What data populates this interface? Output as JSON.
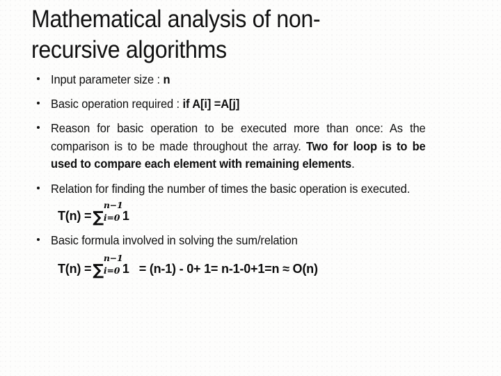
{
  "slide": {
    "title_line1": "Mathematical analysis of non-",
    "title_line2": "recursive algorithms",
    "bullets": [
      {
        "name": "input-parameter-size",
        "plain": "Input parameter size : ",
        "bold": "n",
        "trail": ""
      },
      {
        "name": "basic-operation-required",
        "plain": "Basic operation required : ",
        "bold": "if A[i] =A[j]",
        "trail": ""
      },
      {
        "name": "reason-for-basic-operation",
        "plain": "Reason for basic operation to be executed more than once: As the comparison is to be made throughout the array. ",
        "bold": "Two for loop is to be used to compare each element with remaining elements",
        "trail": "."
      },
      {
        "name": "relation-for-finding-number-of-times",
        "plain": "Relation for finding the number of times the basic operation is executed.",
        "bold": "",
        "trail": ""
      },
      {
        "name": "basic-formula-involved",
        "plain": "Basic formula involved in solving the sum/relation",
        "bold": "",
        "trail": ""
      }
    ],
    "formula_1": {
      "lhs": "T(n) =",
      "sigma": "∑",
      "upper": "n−1",
      "lower": "i=0",
      "summand": "1",
      "tail": ""
    },
    "formula_2": {
      "lhs": "T(n) =",
      "sigma": "∑",
      "upper": "n−1",
      "lower": "i=0",
      "summand": "1",
      "tail": "= (n-1) - 0+ 1= n-1-0+1=n ≈ O(n)"
    },
    "colors": {
      "background": "#fdfdfc",
      "text": "#0d0d0d",
      "title": "#101010"
    }
  }
}
